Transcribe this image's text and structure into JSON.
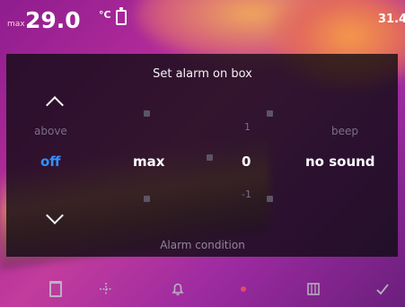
{
  "status": {
    "max_prefix": "max",
    "max_value": "29.0",
    "unit": "°C",
    "right_readout": "31.4"
  },
  "dialog": {
    "title": "Set alarm on box",
    "above_label": "above",
    "above_value": "off",
    "selected_param": "max",
    "value_up": "1",
    "value_current": "0",
    "value_down": "-1",
    "beep_label": "beep",
    "beep_value": "no sound",
    "footer_label": "Alarm condition"
  },
  "toolbar": {
    "icons": [
      "trash-icon",
      "crosshair-icon",
      "bell-icon",
      "color-dot-icon",
      "grid-icon",
      "check-icon"
    ]
  }
}
